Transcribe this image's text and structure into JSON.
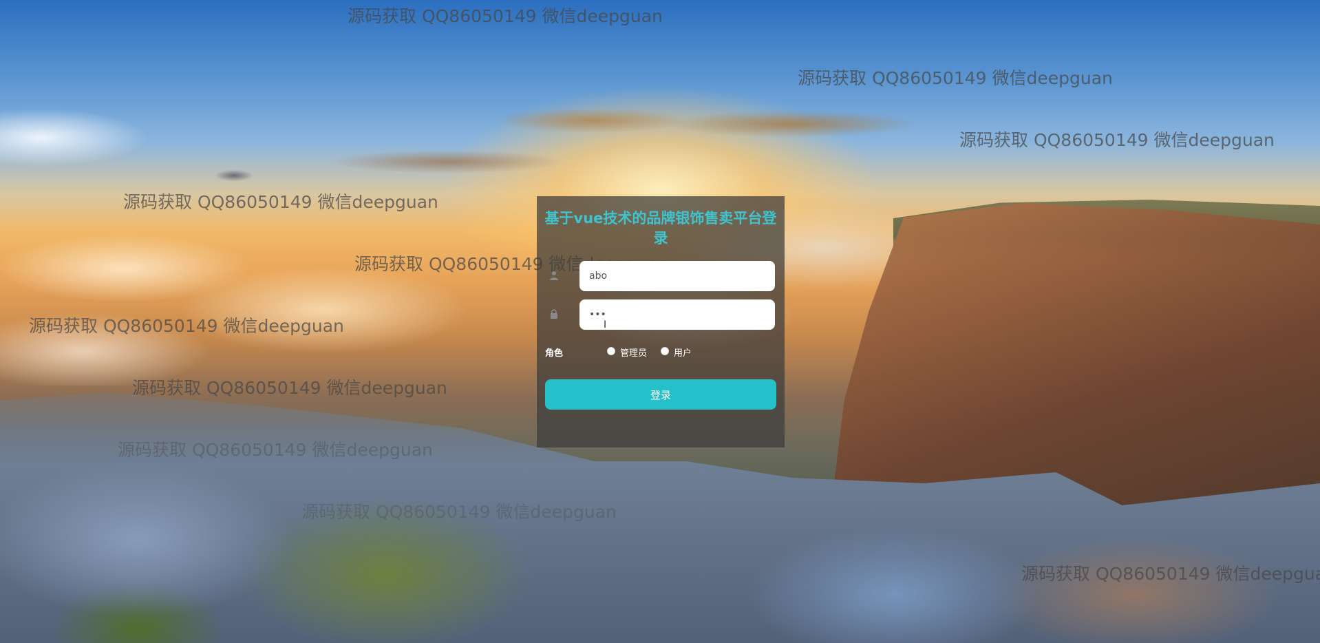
{
  "watermark_text": "源码获取 QQ86050149 微信deepguan",
  "login": {
    "title": "基于vue技术的品牌银饰售卖平台登录",
    "username": {
      "value": "abo"
    },
    "password": {
      "value": "•••"
    },
    "role": {
      "label": "角色",
      "options": [
        "管理员",
        "用户"
      ]
    },
    "submit_label": "登录"
  },
  "icons": {
    "username": "user-icon",
    "password": "lock-icon"
  },
  "colors": {
    "accent": "#25c0c9",
    "title": "#3ec3cf",
    "panel": "rgba(60,60,60,0.72)"
  }
}
